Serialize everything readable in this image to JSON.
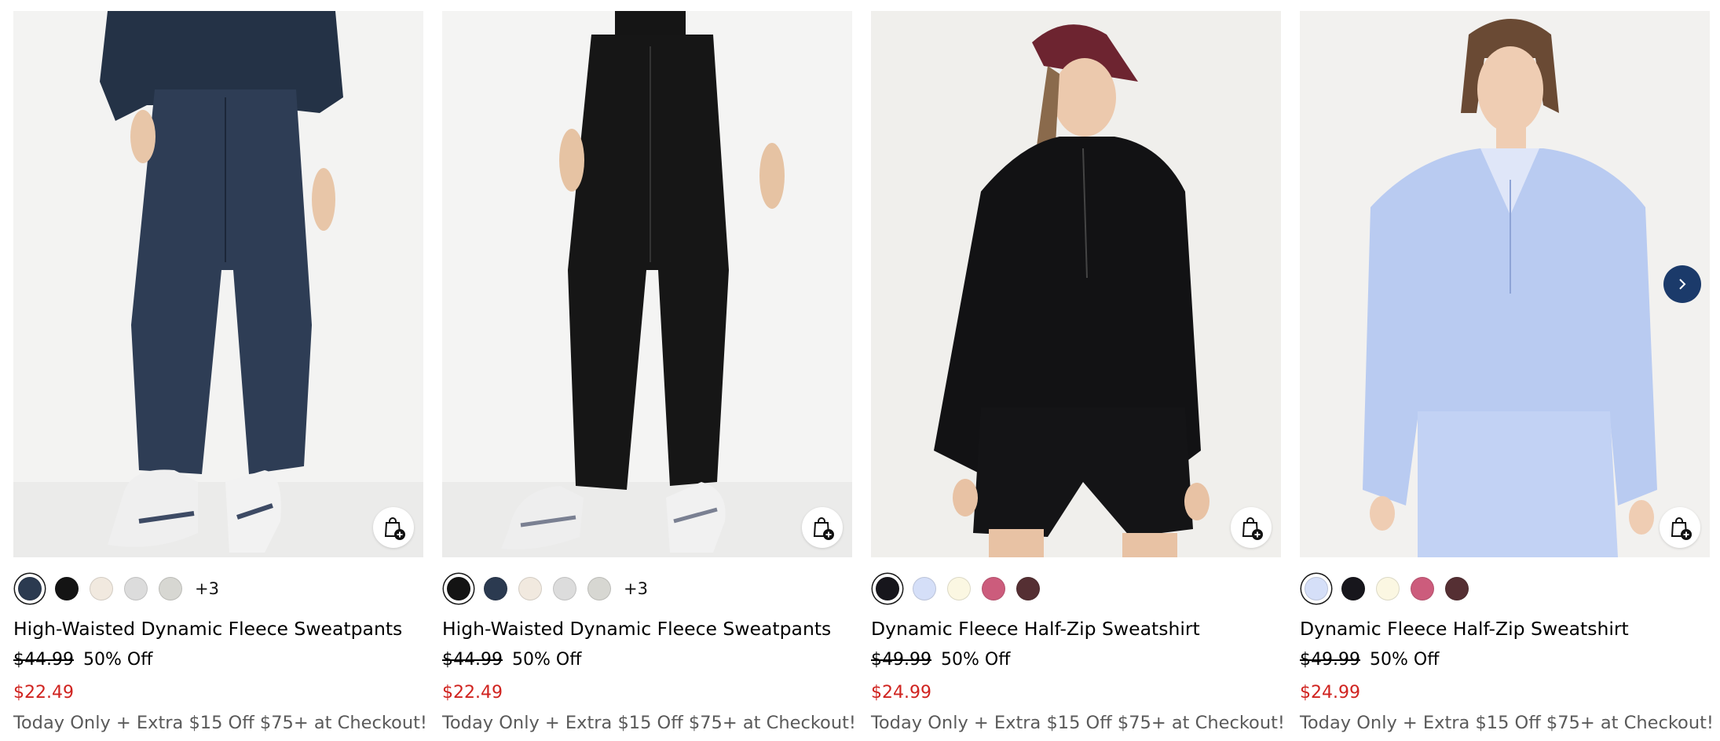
{
  "products": [
    {
      "name": "High-Waisted Dynamic Fleece Sweatpants",
      "regular_price": "$44.99",
      "discount": "50% Off",
      "sale_price": "$22.49",
      "promo": "Today Only + Extra $15 Off $75+ at Checkout!",
      "swatches": [
        "#2b3a50",
        "#141414",
        "#f1e9df",
        "#dcdcdc",
        "#d7d7d2"
      ],
      "more_colors": "+3",
      "image": "model-navy-sweatpants"
    },
    {
      "name": "High-Waisted Dynamic Fleece Sweatpants",
      "regular_price": "$44.99",
      "discount": "50% Off",
      "sale_price": "$22.49",
      "promo": "Today Only + Extra $15 Off $75+ at Checkout!",
      "swatches": [
        "#141414",
        "#2b3a50",
        "#f1e9df",
        "#dcdcdc",
        "#d7d7d2"
      ],
      "more_colors": "+3",
      "image": "model-black-sweatpants"
    },
    {
      "name": "Dynamic Fleece Half-Zip Sweatshirt",
      "regular_price": "$49.99",
      "discount": "50% Off",
      "sale_price": "$24.99",
      "promo": "Today Only + Extra $15 Off $75+ at Checkout!",
      "swatches": [
        "#17161c",
        "#d5dff8",
        "#fbf7e2",
        "#cc5c7c",
        "#552f33"
      ],
      "more_colors": "",
      "image": "model-black-half-zip"
    },
    {
      "name": "Dynamic Fleece Half-Zip Sweatshirt",
      "regular_price": "$49.99",
      "discount": "50% Off",
      "sale_price": "$24.99",
      "promo": "Today Only + Extra $15 Off $75+ at Checkout!",
      "swatches": [
        "#d5dff8",
        "#17161c",
        "#fbf7e2",
        "#cc5c7c",
        "#552f33"
      ],
      "more_colors": "",
      "image": "model-blue-half-zip"
    }
  ],
  "icons": {
    "add_to_bag": "shopping-bag-plus-icon",
    "next": "chevron-right-icon"
  },
  "colors": {
    "sale_red": "#d0231f",
    "nav_button": "#1b3a6a",
    "promo_gray": "#5a5a5a"
  }
}
